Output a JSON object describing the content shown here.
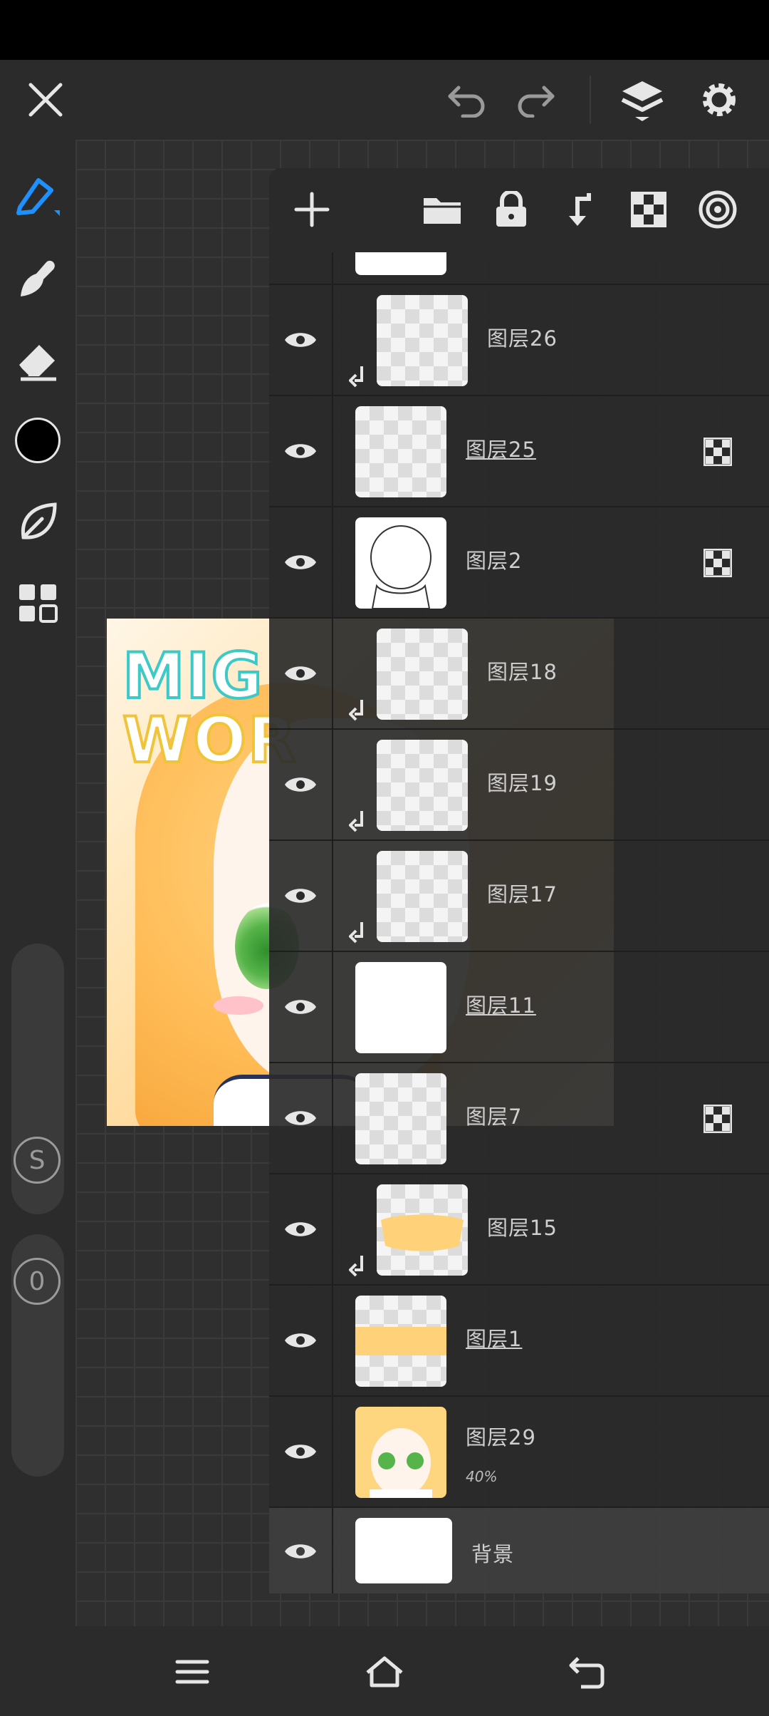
{
  "topbar": {
    "close_icon": "close-icon",
    "undo_icon": "undo-icon",
    "redo_icon": "redo-icon",
    "layers_icon": "layers-icon",
    "settings_icon": "gear-icon"
  },
  "tools": {
    "items": [
      "pen-icon",
      "smudge-icon",
      "eraser-icon",
      "color-swatch",
      "leaf-icon",
      "grid-icon"
    ],
    "active_color": "#000000",
    "accent_color": "#1e90ff",
    "size_badge": "S",
    "opacity_badge": "0"
  },
  "artwork": {
    "title_line1": "MIG",
    "title_line2": "WOR"
  },
  "layer_panel": {
    "toolbar_icons": [
      "add-icon",
      "folder-icon",
      "lock-icon",
      "merge-down-icon",
      "alpha-lock-icon",
      "target-icon"
    ],
    "layers": [
      {
        "name": "图层26",
        "clipped": true,
        "checker": false,
        "underline": false
      },
      {
        "name": "图层25",
        "clipped": false,
        "checker": true,
        "underline": true
      },
      {
        "name": "图层2",
        "clipped": false,
        "checker": true,
        "underline": false
      },
      {
        "name": "图层18",
        "clipped": true,
        "checker": false,
        "underline": false
      },
      {
        "name": "图层19",
        "clipped": true,
        "checker": false,
        "underline": false
      },
      {
        "name": "图层17",
        "clipped": true,
        "checker": false,
        "underline": false
      },
      {
        "name": "图层11",
        "clipped": false,
        "checker": false,
        "underline": true
      },
      {
        "name": "图层7",
        "clipped": false,
        "checker": true,
        "underline": false
      },
      {
        "name": "图层15",
        "clipped": true,
        "checker": false,
        "underline": false
      },
      {
        "name": "图层1",
        "clipped": false,
        "checker": false,
        "underline": true
      },
      {
        "name": "图层29",
        "clipped": false,
        "checker": false,
        "underline": false,
        "opacity": "40%"
      },
      {
        "name": "背景",
        "clipped": false,
        "checker": false,
        "underline": false
      }
    ]
  },
  "navbar": {
    "menu_icon": "menu-icon",
    "home_icon": "home-icon",
    "back_icon": "back-icon"
  }
}
